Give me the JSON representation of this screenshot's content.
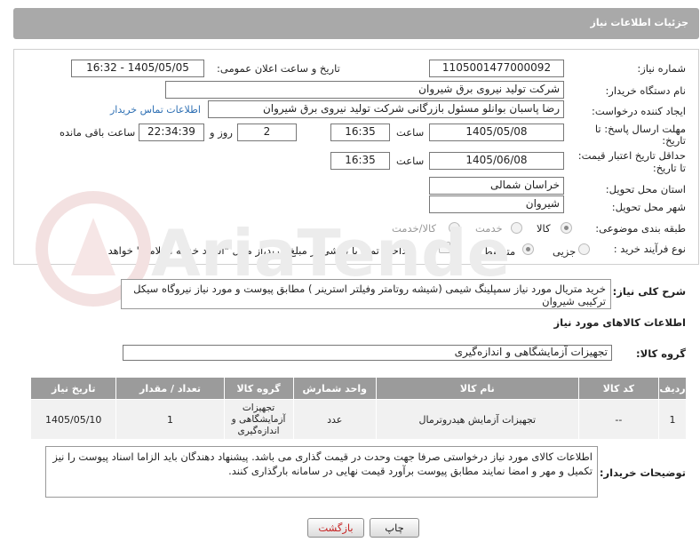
{
  "window": {
    "title": "جزئیات اطلاعات نیاز"
  },
  "form": {
    "need_number": {
      "label": "شماره نیاز:",
      "value": "1105001477000092"
    },
    "announce_datetime": {
      "label": "تاریخ و ساعت اعلان عمومی:",
      "value": "1405/05/05 - 16:32"
    },
    "buyer_org": {
      "label": "نام دستگاه خریدار:",
      "value": "شرکت تولید نیروی برق شیروان"
    },
    "requester": {
      "label": "ایجاد کننده درخواست:",
      "value": "رضا پاسبان بوانلو مسئول بازرگانی شرکت تولید نیروی برق شیروان",
      "contact_link": "اطلاعات تماس خریدار"
    },
    "reply_deadline": {
      "label_line1": "مهلت ارسال پاسخ: تا",
      "label_line2": "تاریخ:",
      "date": "1405/05/08",
      "time_label": "ساعت",
      "time": "16:35",
      "days": "2",
      "days_label": "روز و",
      "remaining": "22:34:39",
      "remaining_label": "ساعت باقی مانده"
    },
    "price_validity": {
      "label_line1": "حداقل تاریخ اعتبار قیمت:",
      "label_line2": "تا تاریخ:",
      "date": "1405/06/08",
      "time_label": "ساعت",
      "time": "16:35"
    },
    "delivery_province": {
      "label": "استان محل تحویل:",
      "value": "خراسان شمالی"
    },
    "delivery_city": {
      "label": "شهر محل تحویل:",
      "value": "شیروان"
    },
    "category": {
      "label": "طبقه بندی موضوعی:",
      "options": [
        "کالا",
        "خدمت",
        "کالا/خدمت"
      ],
      "selected": "کالا"
    },
    "purchase_type": {
      "label": "نوع فرآیند خرید :",
      "options": [
        "جزیی",
        "متوسط"
      ],
      "selected": "متوسط",
      "payment_note": "پرداخت تمام یا بخشی از مبلغ خرید،از محل \"اسناد خزانه اسلامی\" خواهد بود."
    }
  },
  "description": {
    "label": "شرح کلی نیاز:",
    "value": "خرید متریال مورد نیاز سمپلینگ شیمی (شیشه روتامتر وفیلتر استرینر ) مطابق پیوست و مورد نیاز نیروگاه سیکل ترکیبی شیروان"
  },
  "goods": {
    "section_title": "اطلاعات کالاهای مورد نیاز",
    "group_label": "گروه کالا:",
    "group_value": "تجهیزات آزمایشگاهی و اندازه‌گیری",
    "table": {
      "headers": [
        "ردیف",
        "کد کالا",
        "نام کالا",
        "واحد شمارش",
        "گروه کالا",
        "تعداد / مقدار",
        "تاریخ نیاز"
      ],
      "rows": [
        {
          "row": "1",
          "code": "--",
          "name": "تجهیزات آزمایش هیدروترمال",
          "unit": "عدد",
          "group": "تجهیزات آزمایشگاهی و اندازه‌گیری",
          "qty": "1",
          "date": "1405/05/10"
        }
      ]
    }
  },
  "buyer_notes": {
    "label": "توضیحات خریدار:",
    "value": "اطلاعات کالای مورد نیاز درخواستی صرفا جهت وحدت در قیمت گذاری می باشد. پیشنهاد دهندگان باید الزاما اسناد پیوست را نیز تکمیل و مهر و امضا نمایند مطابق پیوست برآورد قیمت نهایی در سامانه بارگذاری کنند."
  },
  "buttons": {
    "print": "چاپ",
    "back": "بازگشت"
  },
  "colors": {
    "header_gray": "#a9a9a9",
    "table_header": "#9b9b9b",
    "link": "#2d6fb3",
    "back_red": "#c62020"
  }
}
